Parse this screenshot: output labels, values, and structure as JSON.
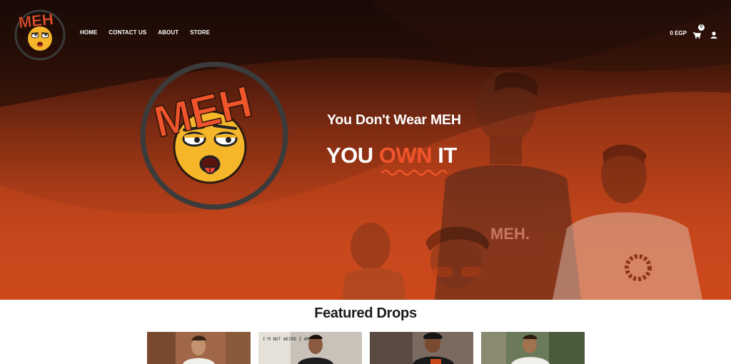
{
  "brand": {
    "logo_text": "MEH"
  },
  "nav": {
    "items": [
      {
        "label": "HOME"
      },
      {
        "label": "CONTACT US"
      },
      {
        "label": "ABOUT"
      },
      {
        "label": "STORE"
      }
    ]
  },
  "cart": {
    "total": "0 EGP",
    "count": "0"
  },
  "hero": {
    "tagline": "You Don't Wear MEH",
    "headline_before": "YOU",
    "headline_accent": "OWN",
    "headline_after": "IT",
    "shirt_print": "MEH."
  },
  "featured": {
    "title": "Featured Drops",
    "cards": [
      {
        "name": "drop-1"
      },
      {
        "name": "drop-2",
        "shirt_text": "I'M NOT WEIRD I AM"
      },
      {
        "name": "drop-3"
      },
      {
        "name": "drop-4"
      }
    ]
  },
  "colors": {
    "accent": "#f0542b",
    "hero_dark": "#1b0c08",
    "hero_orange": "#c9471b",
    "logo_ring": "#3a3a3a",
    "emoji_yellow": "#f5b62a"
  }
}
